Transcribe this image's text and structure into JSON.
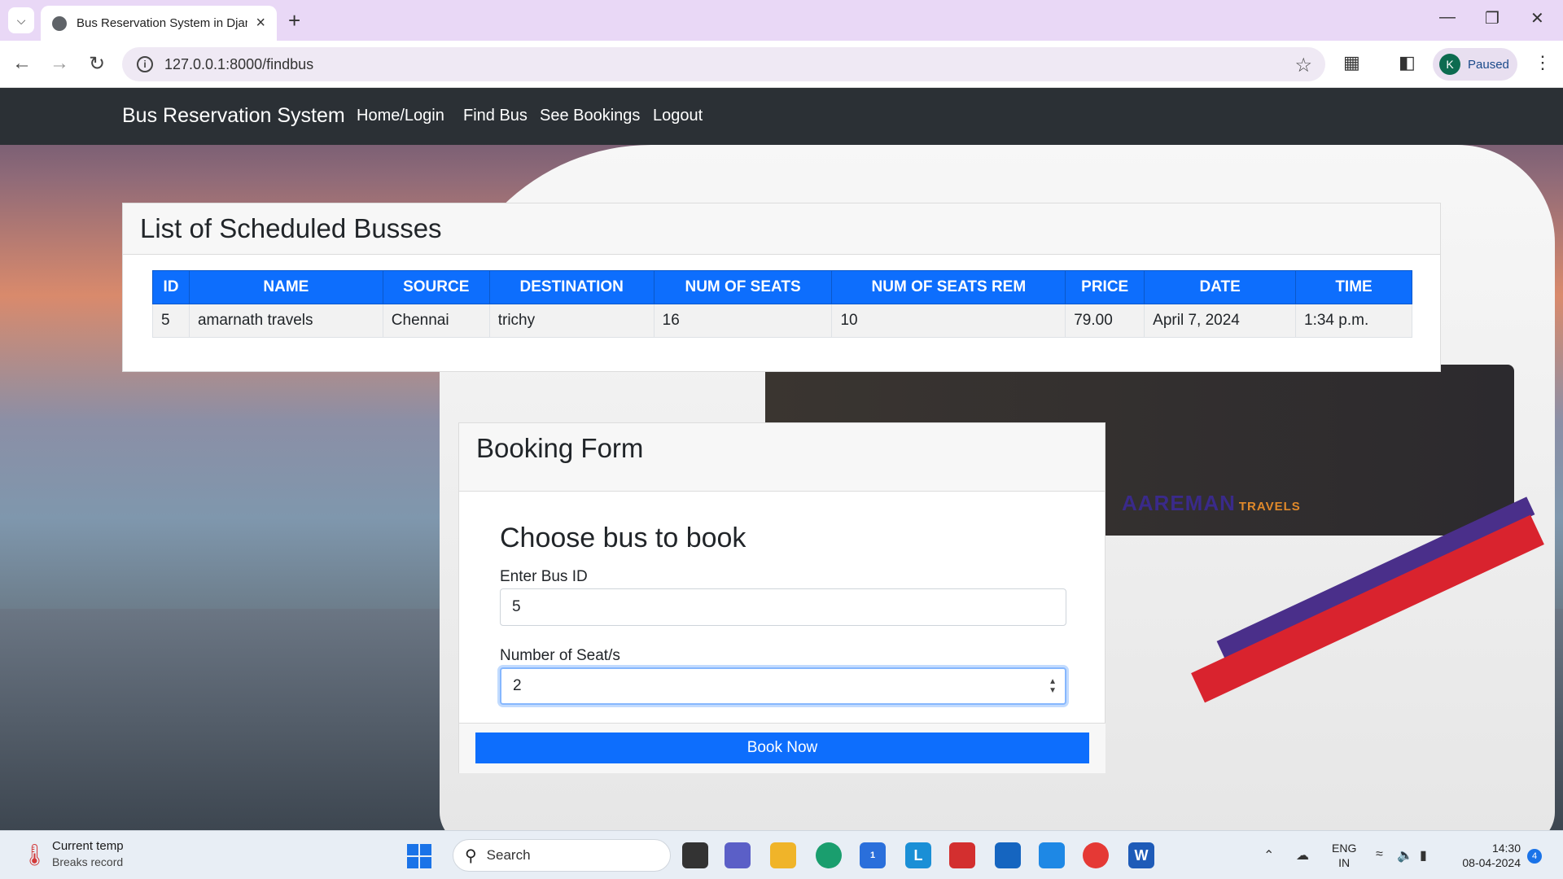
{
  "browser": {
    "tab_title": "Bus Reservation System in Djan",
    "url": "127.0.0.1:8000/findbus",
    "profile_initial": "K",
    "profile_status": "Paused"
  },
  "navbar": {
    "brand": "Bus Reservation System",
    "links": [
      "Home/Login",
      "Find Bus",
      "See Bookings",
      "Logout"
    ]
  },
  "schedule": {
    "title": "List of Scheduled Busses",
    "columns": [
      "ID",
      "NAME",
      "SOURCE",
      "DESTINATION",
      "NUM OF SEATS",
      "NUM OF SEATS REM",
      "PRICE",
      "DATE",
      "TIME"
    ],
    "rows": [
      [
        "5",
        "amarnath travels",
        "Chennai",
        "trichy",
        "16",
        "10",
        "79.00",
        "April 7, 2024",
        "1:34 p.m."
      ]
    ]
  },
  "booking_form": {
    "title": "Booking Form",
    "subtitle": "Choose bus to book",
    "bus_id_label": "Enter Bus ID",
    "bus_id_value": "5",
    "seats_label": "Number of Seat/s",
    "seats_value": "2",
    "submit_label": "Book Now"
  },
  "background": {
    "bus_brand": "AAREMAN",
    "bus_brand_suffix": "TRAVELS"
  },
  "taskbar": {
    "weather_title": "Current temp",
    "weather_subtitle": "Breaks record",
    "search_label": "Search",
    "lang_line1": "ENG",
    "lang_line2": "IN",
    "time": "14:30",
    "date": "08-04-2024",
    "notification_count": "4",
    "store_badge": "1"
  }
}
